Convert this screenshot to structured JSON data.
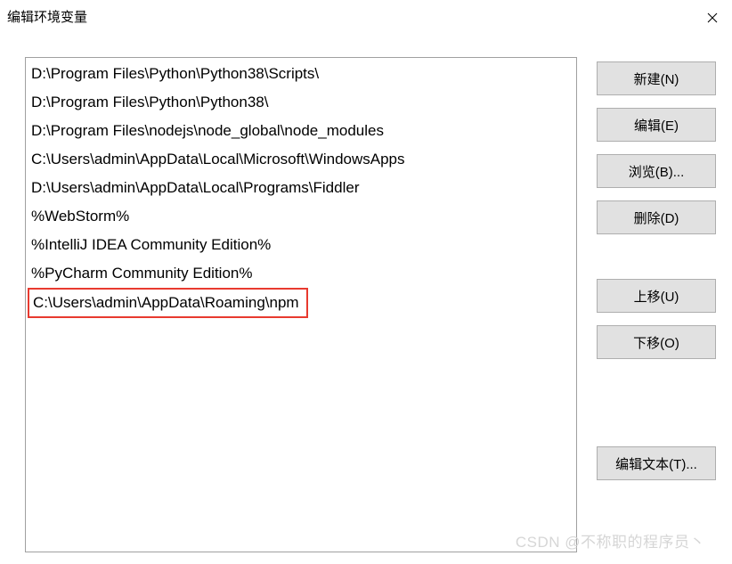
{
  "dialog": {
    "title": "编辑环境变量"
  },
  "list": {
    "items": [
      "D:\\Program Files\\Python\\Python38\\Scripts\\",
      "D:\\Program Files\\Python\\Python38\\",
      "D:\\Program Files\\nodejs\\node_global\\node_modules",
      "C:\\Users\\admin\\AppData\\Local\\Microsoft\\WindowsApps",
      "D:\\Users\\admin\\AppData\\Local\\Programs\\Fiddler",
      "%WebStorm%",
      "%IntelliJ IDEA Community Edition%",
      "%PyCharm Community Edition%",
      "C:\\Users\\admin\\AppData\\Roaming\\npm"
    ],
    "highlighted_index": 8
  },
  "buttons": {
    "new": "新建(N)",
    "edit": "编辑(E)",
    "browse": "浏览(B)...",
    "delete": "删除(D)",
    "move_up": "上移(U)",
    "move_down": "下移(O)",
    "edit_text": "编辑文本(T)..."
  },
  "watermark": "CSDN @不称职的程序员丶"
}
